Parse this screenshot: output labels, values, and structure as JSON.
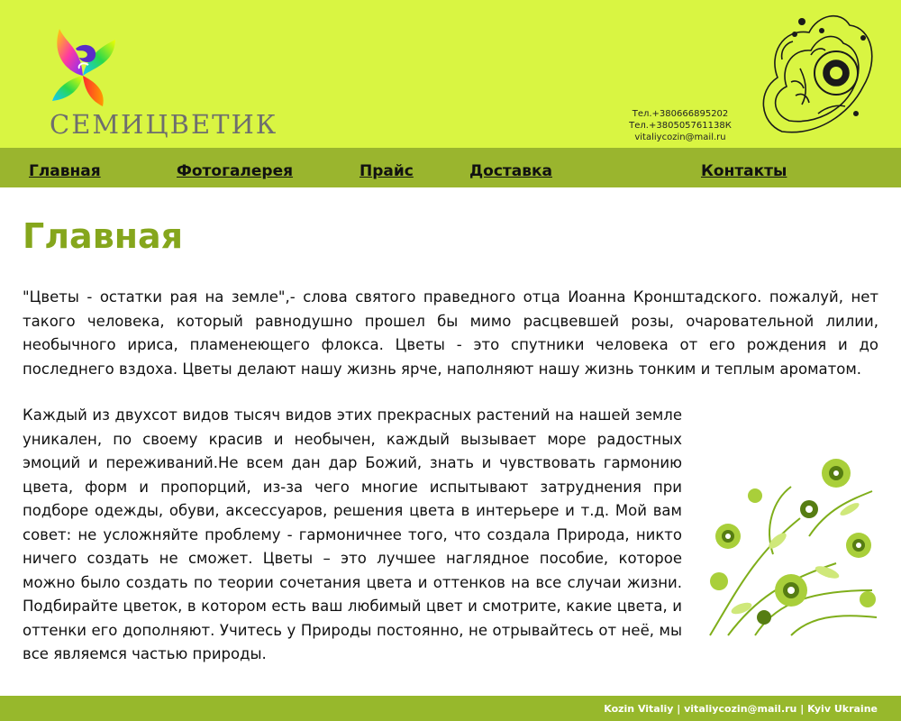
{
  "site": {
    "logo_text": "СЕМИЦВЕТИК"
  },
  "contacts": {
    "phone1": "Тел.+380666895202",
    "phone2": "Тел.+380505761138К",
    "email": "vitaliycozin@mail.ru"
  },
  "nav": {
    "items": [
      {
        "label": "Главная"
      },
      {
        "label": "Фотогалерея"
      },
      {
        "label": "Прайс"
      },
      {
        "label": "Доставка"
      },
      {
        "label": "Контакты"
      }
    ]
  },
  "main": {
    "title": "Главная",
    "paragraphs": [
      "\"Цветы - остатки рая на земле\",- слова святого праведного отца Иоанна Кронштадского. пожалуй, нет такого человека, который равнодушно прошел бы мимо расцвевшей розы, очаровательной лилии, необычного ириса, пламенеющего флокса. Цветы - это спутники человека от его рождения и до последнего вздоха. Цветы делают нашу жизнь ярче, наполняют нашу жизнь тонким и теплым ароматом.",
      "Каждый из двухсот видов тысяч видов этих прекрасных растений на нашей земле уникален, по своему красив и необычен, каждый вызывает море радостных эмоций и переживаний.Не всем дан дар Божий, знать и чувствовать гармонию цвета, форм и пропорций, из-за чего многие испытывают затруднения при подборе одежды, обуви, аксессуаров, решения цвета в интерьере и т.д. Мой вам совет: не усложняйте проблему - гармоничнее того, что создала Природа, никто ничего создать не сможет. Цветы – это лучшее наглядное пособие, которое можно было создать по теории сочетания цвета и оттенков на все случаи жизни. Подбирайте цветок, в котором есть ваш любимый цвет и смотрите, какие цвета, и оттенки его дополняют. Учитесь у Природы постоянно, не отрывайтесь от неё, мы все являемся частью природы."
    ]
  },
  "footer": {
    "text": "Kozin Vitaliy | vitaliycozin@mail.ru | Kyiv Ukraine"
  },
  "colors": {
    "header_bg": "#d9f542",
    "nav_bg": "#9ab52e",
    "title": "#85a61c",
    "footer_bg": "#97b82c"
  }
}
